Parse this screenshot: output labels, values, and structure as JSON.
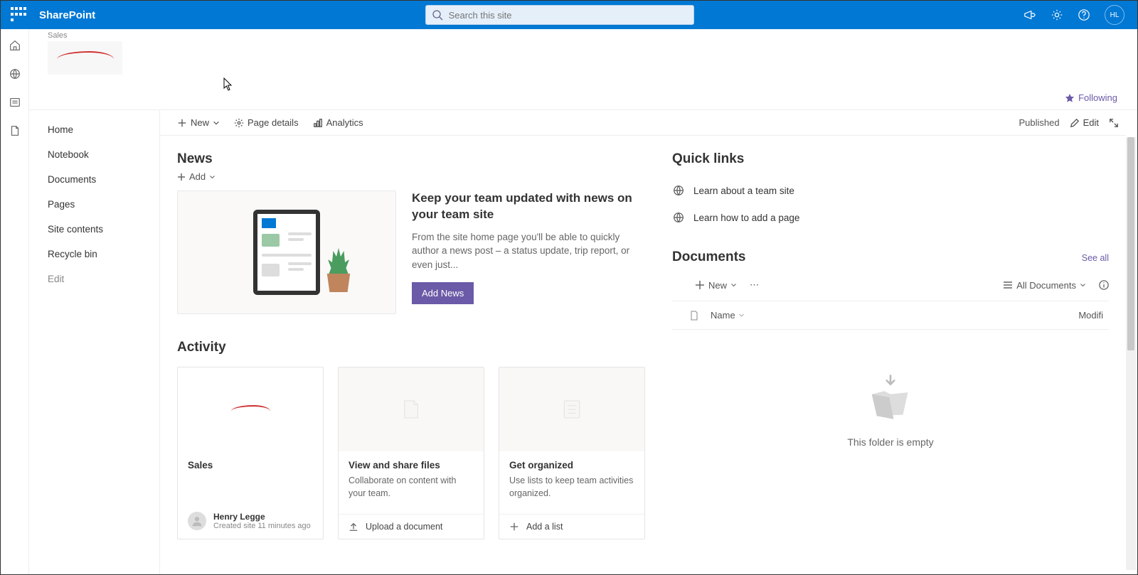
{
  "header": {
    "app_name": "SharePoint",
    "search_placeholder": "Search this site",
    "avatar_initials": "HL"
  },
  "site": {
    "label": "Sales"
  },
  "follow_label": "Following",
  "leftnav": {
    "items": [
      "Home",
      "Notebook",
      "Documents",
      "Pages",
      "Site contents",
      "Recycle bin"
    ],
    "edit": "Edit"
  },
  "cmdbar": {
    "new": "New",
    "page_details": "Page details",
    "analytics": "Analytics",
    "published": "Published",
    "edit": "Edit"
  },
  "news": {
    "title": "News",
    "add": "Add",
    "heading": "Keep your team updated with news on your team site",
    "desc": "From the site home page you'll be able to quickly author a news post – a status update, trip report, or even just...",
    "button": "Add News"
  },
  "activity": {
    "title": "Activity",
    "cards": [
      {
        "title": "Sales",
        "author": "Henry Legge",
        "meta": "Created site 11 minutes ago"
      },
      {
        "title": "View and share files",
        "desc": "Collaborate on content with your team.",
        "footer": "Upload a document"
      },
      {
        "title": "Get organized",
        "desc": "Use lists to keep team activities organized.",
        "footer": "Add a list"
      }
    ]
  },
  "quicklinks": {
    "title": "Quick links",
    "items": [
      "Learn about a team site",
      "Learn how to add a page"
    ]
  },
  "documents": {
    "title": "Documents",
    "see_all": "See all",
    "new": "New",
    "all_docs": "All Documents",
    "th_name": "Name",
    "th_modified": "Modifi",
    "empty": "This folder is empty"
  }
}
